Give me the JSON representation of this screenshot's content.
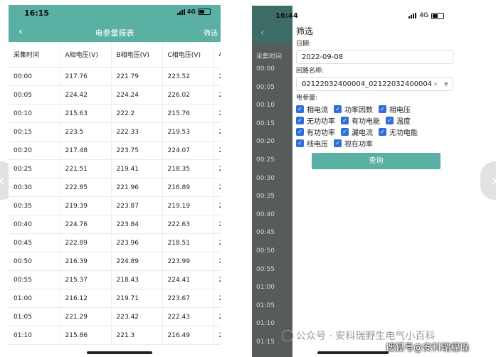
{
  "left_screen": {
    "status_time": "16:15",
    "network": "4G",
    "nav_title": "电参量报表",
    "filter_label": "筛选",
    "columns": [
      "采集时间",
      "A相电压(V)",
      "B相电压(V)",
      "C相电压(V)",
      "A"
    ],
    "rows": [
      [
        "00:00",
        "217.76",
        "221.79",
        "223.52",
        "2"
      ],
      [
        "00:05",
        "224.42",
        "224.24",
        "226.02",
        "2"
      ],
      [
        "00:10",
        "215.63",
        "222.2",
        "215.76",
        "2"
      ],
      [
        "00:15",
        "223.5",
        "222.33",
        "219.53",
        "2"
      ],
      [
        "00:20",
        "217.48",
        "223.75",
        "224.07",
        "2"
      ],
      [
        "00:25",
        "221.51",
        "219.41",
        "218.35",
        "2"
      ],
      [
        "00:30",
        "222.85",
        "221.96",
        "216.89",
        "2"
      ],
      [
        "00:35",
        "219.39",
        "223.87",
        "219.19",
        "2"
      ],
      [
        "00:40",
        "224.76",
        "223.84",
        "222.63",
        "2"
      ],
      [
        "00:45",
        "222.89",
        "223.96",
        "218.51",
        "2"
      ],
      [
        "00:50",
        "216.39",
        "224.89",
        "223.99",
        "2"
      ],
      [
        "00:55",
        "215.37",
        "218.43",
        "224.41",
        "2"
      ],
      [
        "01:00",
        "216.12",
        "219.71",
        "223.67",
        "2"
      ],
      [
        "01:05",
        "221.29",
        "223.42",
        "222.43",
        "2"
      ],
      [
        "01:10",
        "215.86",
        "221.3",
        "216.49",
        "2"
      ]
    ]
  },
  "right_screen": {
    "status_time": "16:44",
    "network": "4G",
    "background_column_header": "采集时间",
    "background_times": [
      "00:00",
      "00:05",
      "00:10",
      "00:15",
      "00:20",
      "00:25",
      "00:30",
      "00:35",
      "00:40",
      "00:45",
      "00:50",
      "00:55",
      "01:00",
      "01:05",
      "01:10",
      "01:15"
    ],
    "filter_title": "筛选",
    "date_label": "日期:",
    "date_value": "2022-09-08",
    "circuit_label": "回路名称:",
    "circuit_value": "02122032400004_02122032400004",
    "clear_icon": "×",
    "quantity_label": "电参量:",
    "checkbox_rows": [
      [
        "相电流",
        "功率因数",
        "相电压"
      ],
      [
        "无功功率",
        "有功电能",
        "温度"
      ],
      [
        "有功功率",
        "漏电流",
        "无功电能"
      ],
      [
        "线电压",
        "视在功率"
      ]
    ],
    "query_button": "查询"
  },
  "watermark_1": "公众号 · 安科瑞野生电气小百科",
  "watermark_2": "搜狐号@安科瑞程瑜",
  "colors": {
    "teal": "#5bb0a4",
    "checkbox_blue": "#2f6fd6",
    "dim_overlay": "#555c5a"
  }
}
